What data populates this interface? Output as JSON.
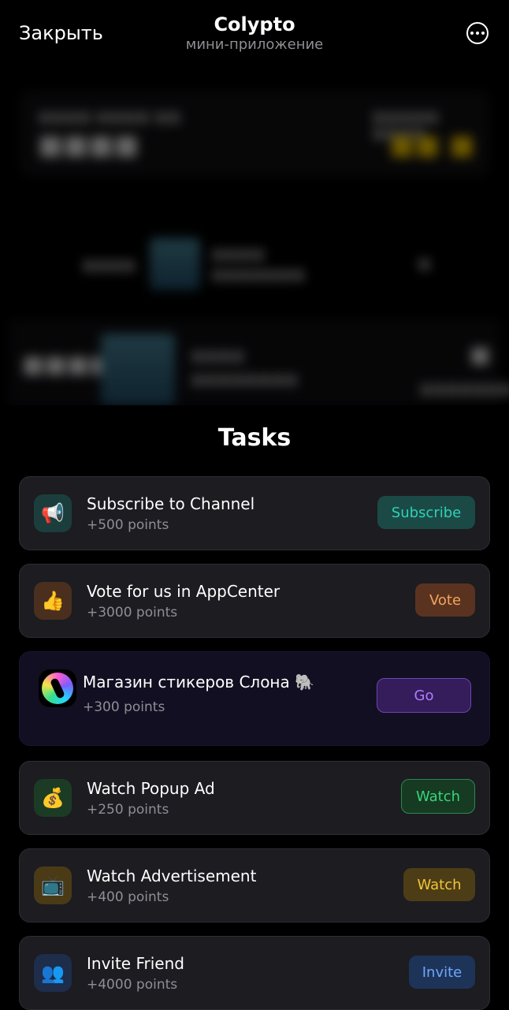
{
  "header": {
    "close_label": "Закрыть",
    "title": "Colypto",
    "subtitle": "мини-приложение",
    "menu_icon": "more-horizontal-icon"
  },
  "tasks": {
    "heading": "Tasks",
    "items": [
      {
        "icon": "megaphone-icon",
        "glyph": "📢",
        "title": "Subscribe to Channel",
        "points": "+500 points",
        "button": "Subscribe",
        "accent": "#2fd0b6"
      },
      {
        "icon": "thumbs-up-icon",
        "glyph": "👍",
        "title": "Vote for us in AppCenter",
        "points": "+3000 points",
        "button": "Vote",
        "accent": "#f3a45c"
      },
      {
        "icon": "sticker-store-logo",
        "glyph": "",
        "title": "Магазин стикеров Слона 🐘",
        "points": "+300 points",
        "button": "Go",
        "accent": "#b07cff"
      },
      {
        "icon": "money-bag-icon",
        "glyph": "💰",
        "title": "Watch Popup Ad",
        "points": "+250 points",
        "button": "Watch",
        "accent": "#36d67a"
      },
      {
        "icon": "television-icon",
        "glyph": "📺",
        "title": "Watch Advertisement",
        "points": "+400 points",
        "button": "Watch",
        "accent": "#f2c43a"
      },
      {
        "icon": "users-icon",
        "glyph": "👥",
        "title": "Invite Friend",
        "points": "+4000 points",
        "button": "Invite",
        "accent": "#6aa8ff"
      }
    ]
  }
}
